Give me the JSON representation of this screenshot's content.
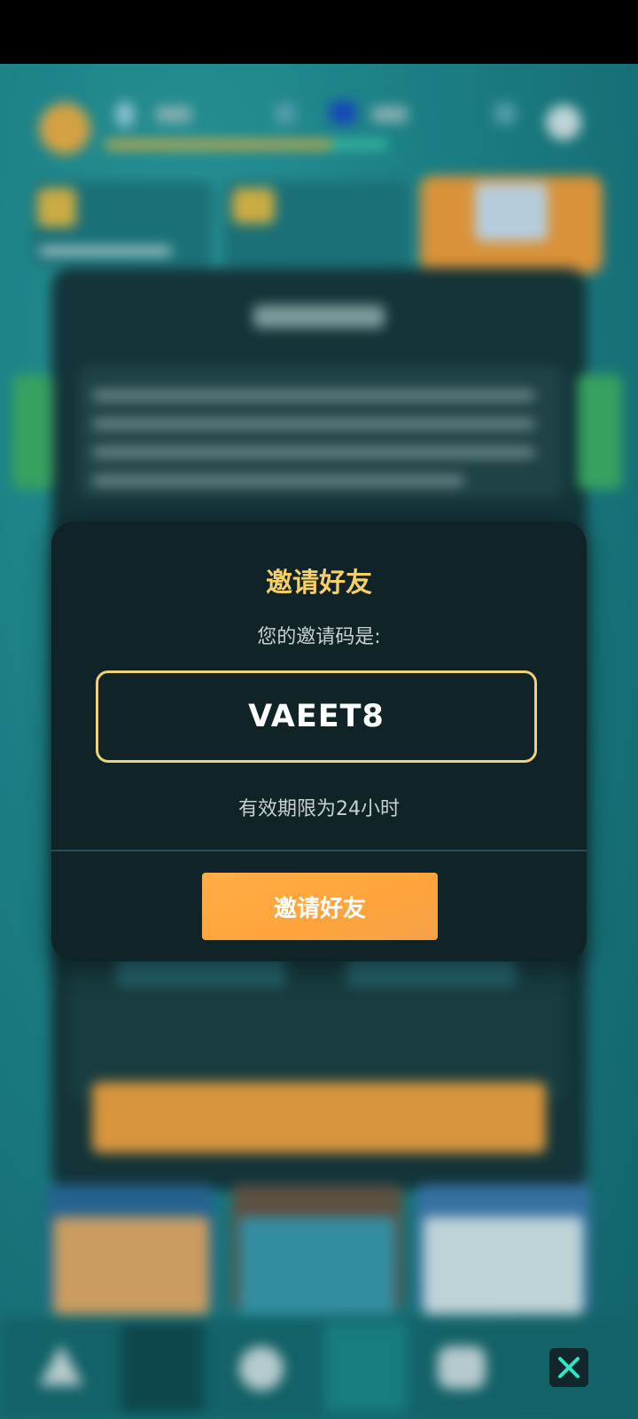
{
  "modal": {
    "title": "邀请好友",
    "subtitle": "您的邀请码是:",
    "invite_code": "VAEET8",
    "validity_text": "有效期限为24小时",
    "button_label": "邀请好友"
  },
  "icons": {
    "close": "close-icon"
  },
  "colors": {
    "title": "#f6cf69",
    "accent_button": "#ffa43c",
    "code_border": "#f1d07a",
    "modal_bg": "#102326"
  }
}
